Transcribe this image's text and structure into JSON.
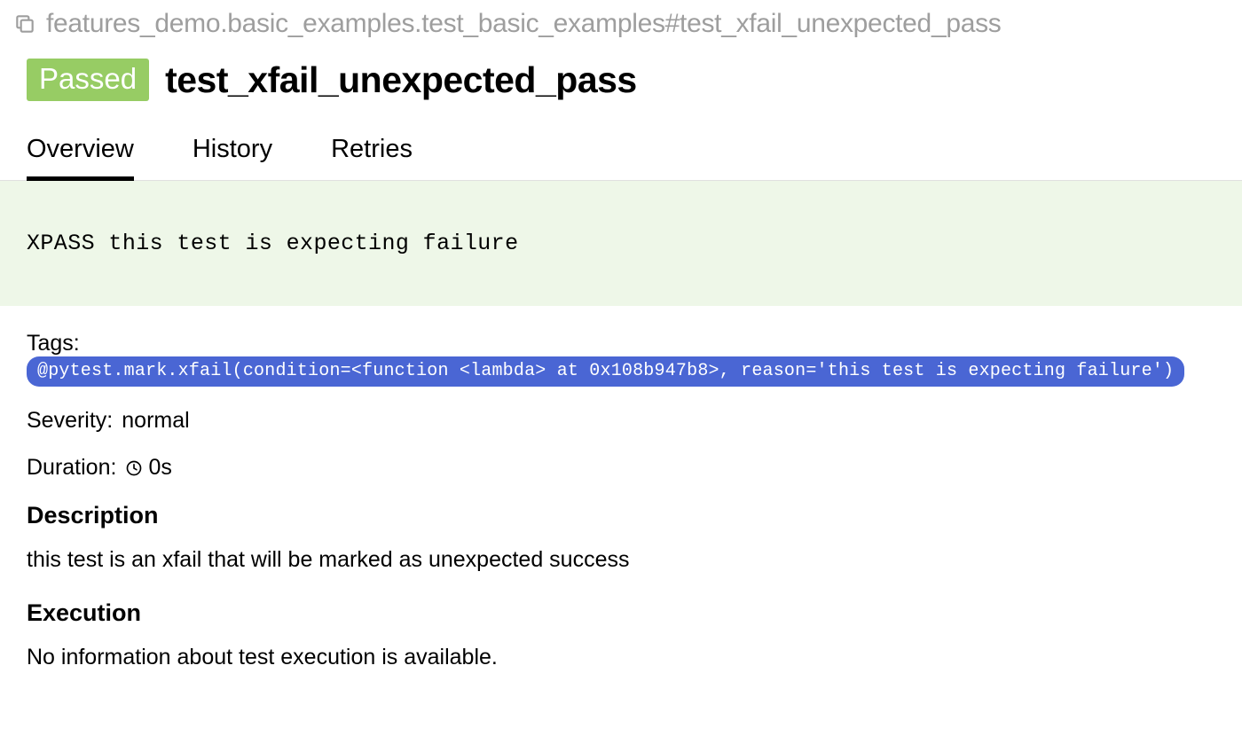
{
  "breadcrumb": "features_demo.basic_examples.test_basic_examples#test_xfail_unexpected_pass",
  "status_label": "Passed",
  "title": "test_xfail_unexpected_pass",
  "tabs": {
    "overview": "Overview",
    "history": "History",
    "retries": "Retries"
  },
  "status_message": "XPASS this test is expecting failure",
  "tags": {
    "label": "Tags:",
    "chip": "@pytest.mark.xfail(condition=<function <lambda> at 0x108b947b8>, reason='this test is expecting failure')"
  },
  "severity": {
    "label": "Severity:",
    "value": "normal"
  },
  "duration": {
    "label": "Duration:",
    "value": "0s"
  },
  "description": {
    "heading": "Description",
    "body": "this test is an xfail that will be marked as unexpected success"
  },
  "execution": {
    "heading": "Execution",
    "body": "No information about test execution is available."
  }
}
